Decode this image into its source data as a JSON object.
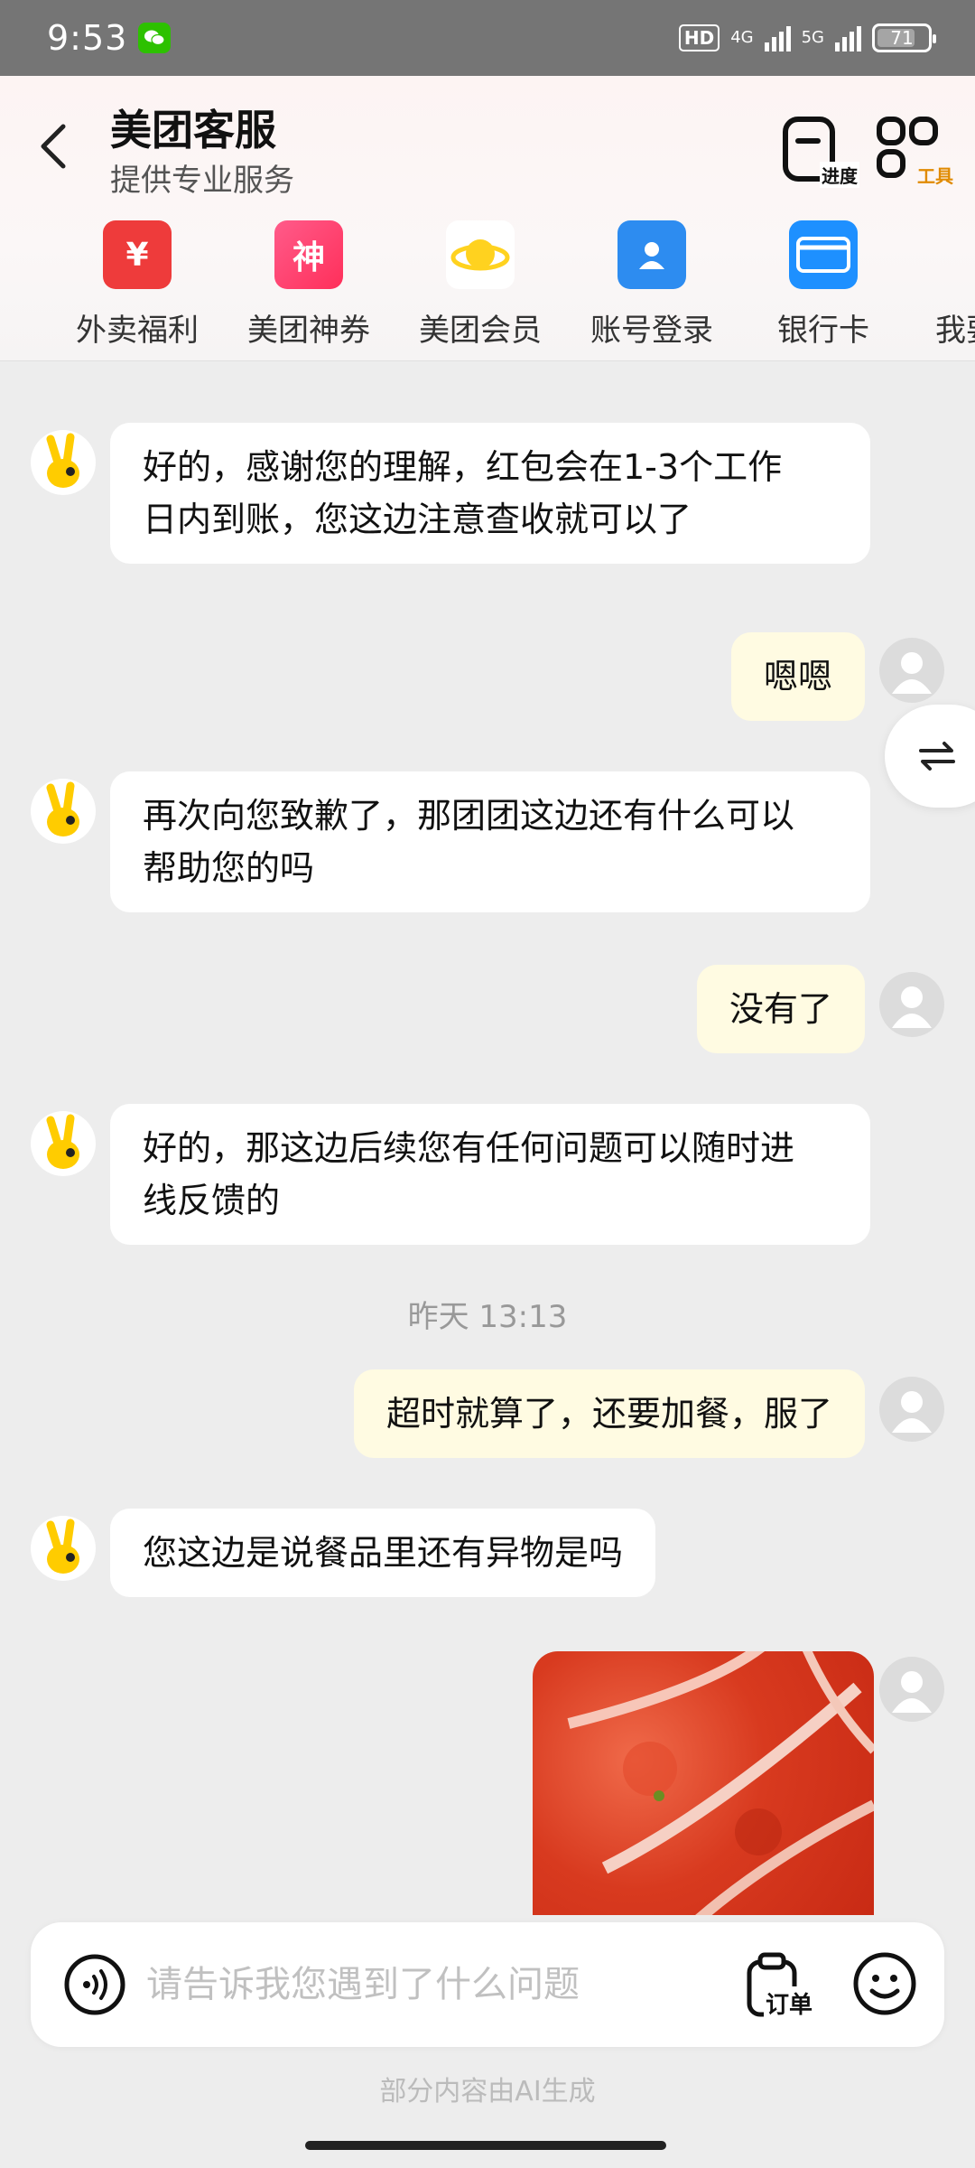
{
  "status_bar": {
    "time": "9:53",
    "hd": "HD",
    "network_1": "4G",
    "network_2": "5G",
    "battery": "71"
  },
  "header": {
    "title": "美团客服",
    "subtitle": "提供专业服务",
    "progress_label": "进度",
    "tools_label": "工具"
  },
  "quick_entries": [
    {
      "label": "外卖福利",
      "icon": "red-envelope-icon",
      "color": "#ee3b3b"
    },
    {
      "label": "美团神券",
      "icon": "coupon-icon",
      "color": "#ff3b7a"
    },
    {
      "label": "美团会员",
      "icon": "member-icon",
      "color": "#ffd21f"
    },
    {
      "label": "账号登录",
      "icon": "account-icon",
      "color": "#2d8cf0"
    },
    {
      "label": "银行卡",
      "icon": "bank-card-icon",
      "color": "#1e90ff"
    },
    {
      "label": "我要",
      "icon": "more-icon",
      "color": "#2d8cf0"
    }
  ],
  "messages": [
    {
      "from": "bot",
      "text_1": "好的，感谢您的理解，红包会在1-3个工作",
      "text_2": "日内到账，您这边注意查收就可以了"
    },
    {
      "from": "user",
      "text": "嗯嗯"
    },
    {
      "from": "bot",
      "text_1": "再次向您致歉了，那团团这边还有什么可以",
      "text_2": "帮助您的吗"
    },
    {
      "from": "user",
      "text": "没有了"
    },
    {
      "from": "bot",
      "text_1": "好的，那这边后续您有任何问题可以随时进",
      "text_2": "线反馈的"
    },
    {
      "from": "user",
      "text": "超时就算了，还要加餐，服了"
    },
    {
      "from": "bot",
      "text": "您这边是说餐品里还有异物是吗"
    }
  ],
  "timestamp": "昨天 13:13",
  "input": {
    "placeholder": "请告诉我您遇到了什么问题",
    "order_label": "订单"
  },
  "footer_note": "部分内容由AI生成",
  "colors": {
    "bot_bubble": "#ffffff",
    "user_bubble": "#fffbe2",
    "brand_yellow": "#ffd21f"
  }
}
